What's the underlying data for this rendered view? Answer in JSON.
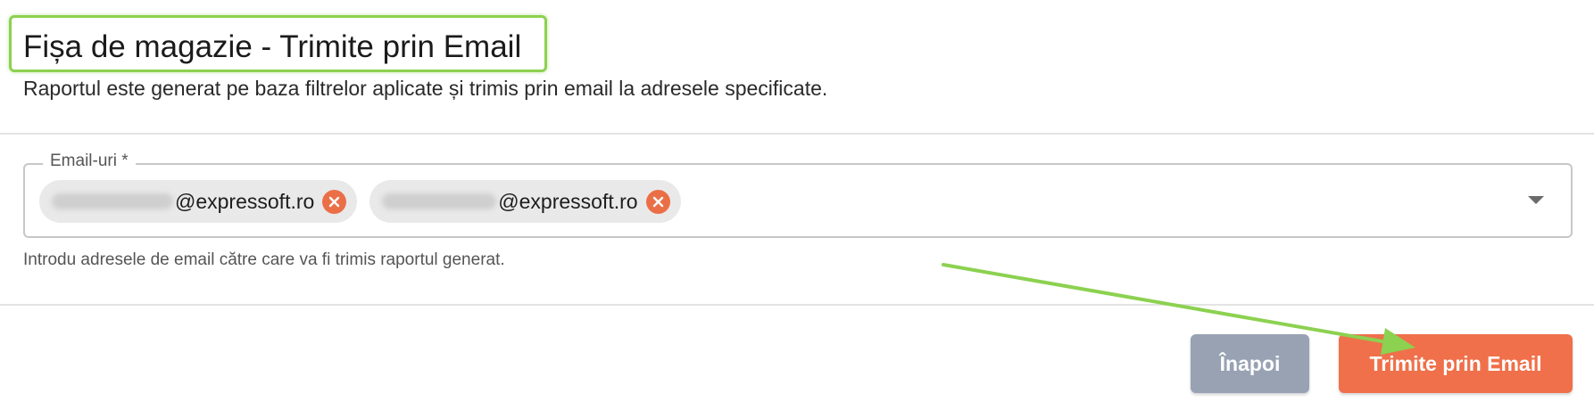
{
  "header": {
    "title": "Fișa de magazie - Trimite prin Email",
    "subtitle": "Raportul este generat pe baza filtrelor aplicate și trimis prin email la adresele specificate."
  },
  "email_field": {
    "label": "Email-uri *",
    "chips": [
      {
        "domain_part": "@expressoft.ro",
        "local_part_redacted": true
      },
      {
        "domain_part": "@expressoft.ro",
        "local_part_redacted": true
      }
    ],
    "helper_text": "Introdu adresele de email către care va fi trimis raportul generat."
  },
  "actions": {
    "back_label": "Înapoi",
    "send_label": "Trimite prin Email"
  },
  "colors": {
    "highlight": "#8cd150",
    "chip_remove": "#ea6f47",
    "back_button": "#98a2b3",
    "send_button": "#ef704a"
  }
}
